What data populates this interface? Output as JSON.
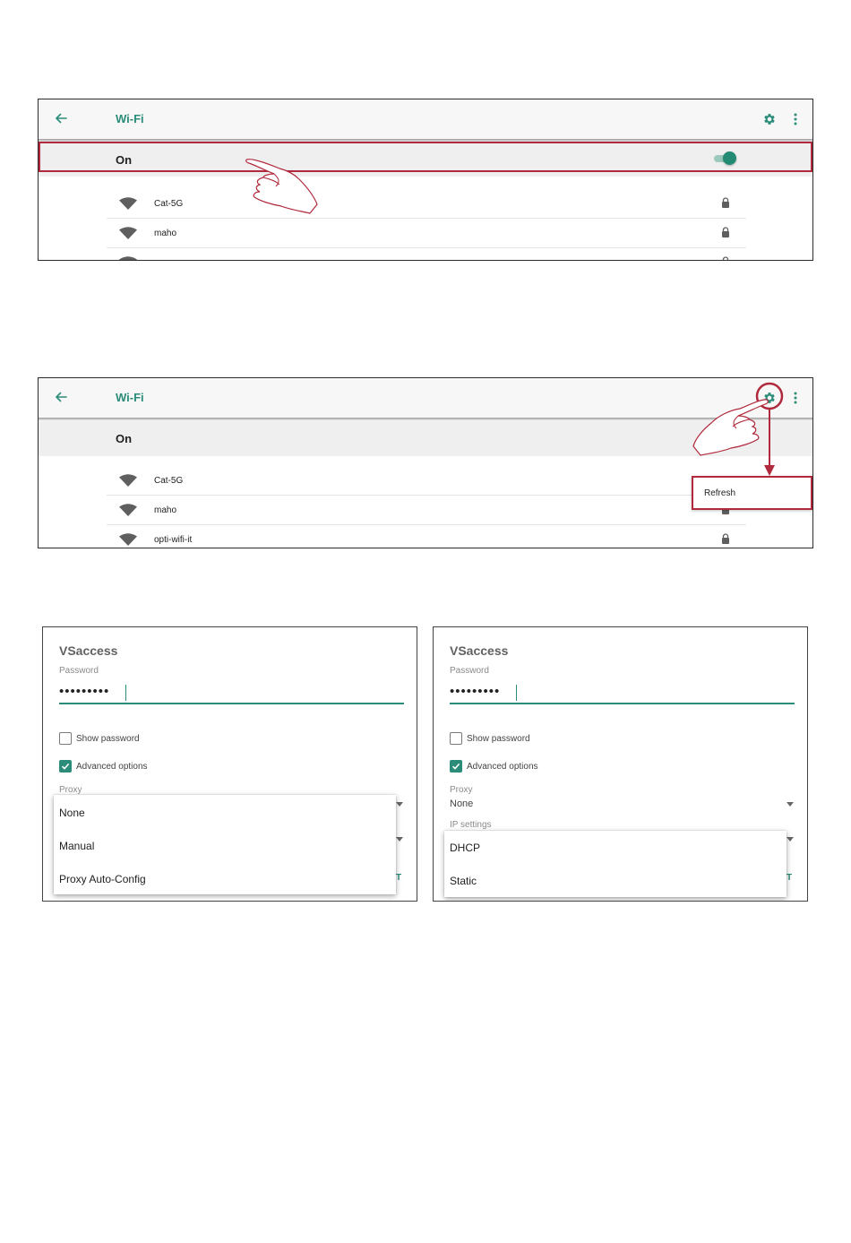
{
  "screen1": {
    "app_title": "Wi-Fi",
    "toggle_label": "On",
    "toggle_state": "on",
    "networks": [
      {
        "name": "Cat-5G",
        "secured": true
      },
      {
        "name": "maho",
        "secured": true
      }
    ]
  },
  "screen2": {
    "app_title": "Wi-Fi",
    "toggle_label": "On",
    "networks": [
      {
        "name": "Cat-5G",
        "secured": true
      },
      {
        "name": "maho",
        "secured": true
      },
      {
        "name": "opti-wifi-it",
        "secured": true
      }
    ],
    "menu": {
      "refresh_label": "Refresh"
    }
  },
  "dialog1": {
    "network_name": "VSaccess",
    "password_label": "Password",
    "password_value": "•••••••••",
    "show_password_label": "Show password",
    "advanced_options_label": "Advanced options",
    "proxy_label": "Proxy",
    "proxy_options": [
      "None",
      "Manual",
      "Proxy Auto-Config"
    ]
  },
  "dialog2": {
    "network_name": "VSaccess",
    "password_label": "Password",
    "password_value": "•••••••••",
    "show_password_label": "Show password",
    "advanced_options_label": "Advanced options",
    "proxy_label": "Proxy",
    "proxy_value": "None",
    "ip_settings_label": "IP settings",
    "ip_options": [
      "DHCP",
      "Static"
    ]
  },
  "colors": {
    "accent": "#2a8c79",
    "highlight_red": "#b0293c",
    "divider": "#e4e4e4"
  },
  "icons": [
    "back-arrow-icon",
    "gear-icon",
    "more-vert-icon",
    "wifi-icon",
    "lock-icon",
    "pointing-hand-icon",
    "checkbox-icon",
    "dropdown-arrow-icon"
  ]
}
